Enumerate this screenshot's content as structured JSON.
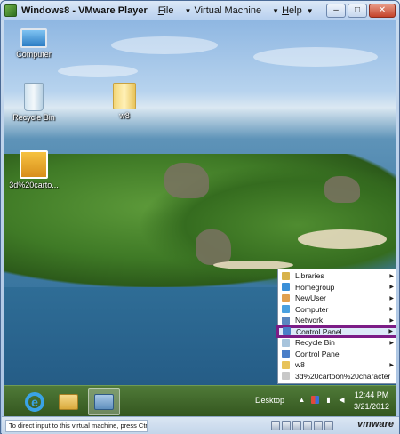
{
  "window": {
    "title": "Windows8 - VMware Player",
    "menus": [
      {
        "accel": "F",
        "rest": "ile"
      },
      {
        "accel": "",
        "rest": "Virtual Machine"
      },
      {
        "accel": "H",
        "rest": "elp"
      }
    ],
    "minimize": "–",
    "maximize": "□",
    "close": "✕"
  },
  "desktop_icons": {
    "computer": "Computer",
    "recycle_bin": "Recycle Bin",
    "w8": "w8",
    "cartoon": "3d%20carto..."
  },
  "jumplist": {
    "items": [
      {
        "label": "Libraries",
        "icon_color": "#d8b24a",
        "submenu": true
      },
      {
        "label": "Homegroup",
        "icon_color": "#3a8fd8",
        "submenu": true
      },
      {
        "label": "NewUser",
        "icon_color": "#e0a050",
        "submenu": true
      },
      {
        "label": "Computer",
        "icon_color": "#4aa0e0",
        "submenu": true
      },
      {
        "label": "Network",
        "icon_color": "#5a86c0",
        "submenu": true
      },
      {
        "label": "Control Panel",
        "icon_color": "#4a7ec8",
        "submenu": true,
        "highlighted": true
      },
      {
        "label": "Recycle Bin",
        "icon_color": "#a8c4dc",
        "submenu": true
      },
      {
        "label": "Control Panel",
        "icon_color": "#4a7ec8",
        "submenu": false
      },
      {
        "label": "w8",
        "icon_color": "#e8c35a",
        "submenu": true
      },
      {
        "label": "3d%20cartoon%20character",
        "icon_color": "#c8c8c8",
        "submenu": false
      }
    ],
    "arrow": "▶"
  },
  "taskbar": {
    "desktop_label": "Desktop",
    "tray_chevron": "▲",
    "time": "12:44 PM",
    "date": "3/21/2012"
  },
  "statusbar": {
    "message": "To direct input to this virtual machine, press Ctrl+G.",
    "logo": "vmware"
  }
}
